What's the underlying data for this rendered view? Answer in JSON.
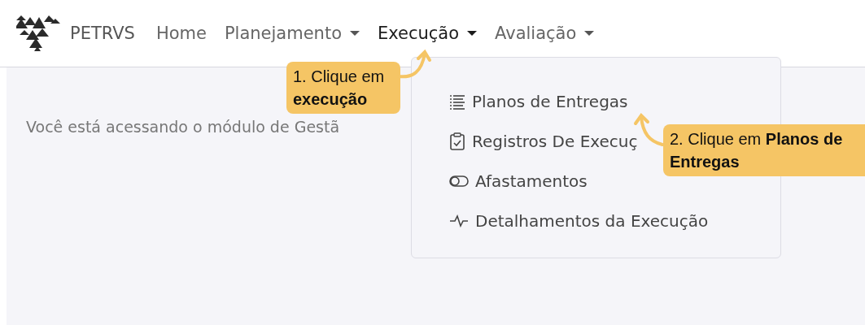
{
  "brand": {
    "name": "PETRVS"
  },
  "nav": [
    {
      "label": "Home",
      "dropdown": false,
      "selected": false
    },
    {
      "label": "Planejamento",
      "dropdown": true,
      "selected": false
    },
    {
      "label": "Execução",
      "dropdown": true,
      "selected": true
    },
    {
      "label": "Avaliação",
      "dropdown": true,
      "selected": false
    }
  ],
  "page": {
    "message": "Você está acessando o módulo de Gestã"
  },
  "dropdown_menu": {
    "items": [
      {
        "label": "Planos de Entregas"
      },
      {
        "label": "Registros De Execuç"
      },
      {
        "label": "Afastamentos"
      },
      {
        "label": "Detalhamentos da Execução"
      }
    ]
  },
  "callouts": [
    {
      "text": "1. Clique em **execução**"
    },
    {
      "text": "2. Clique em **Planos de Entregas**"
    }
  ]
}
